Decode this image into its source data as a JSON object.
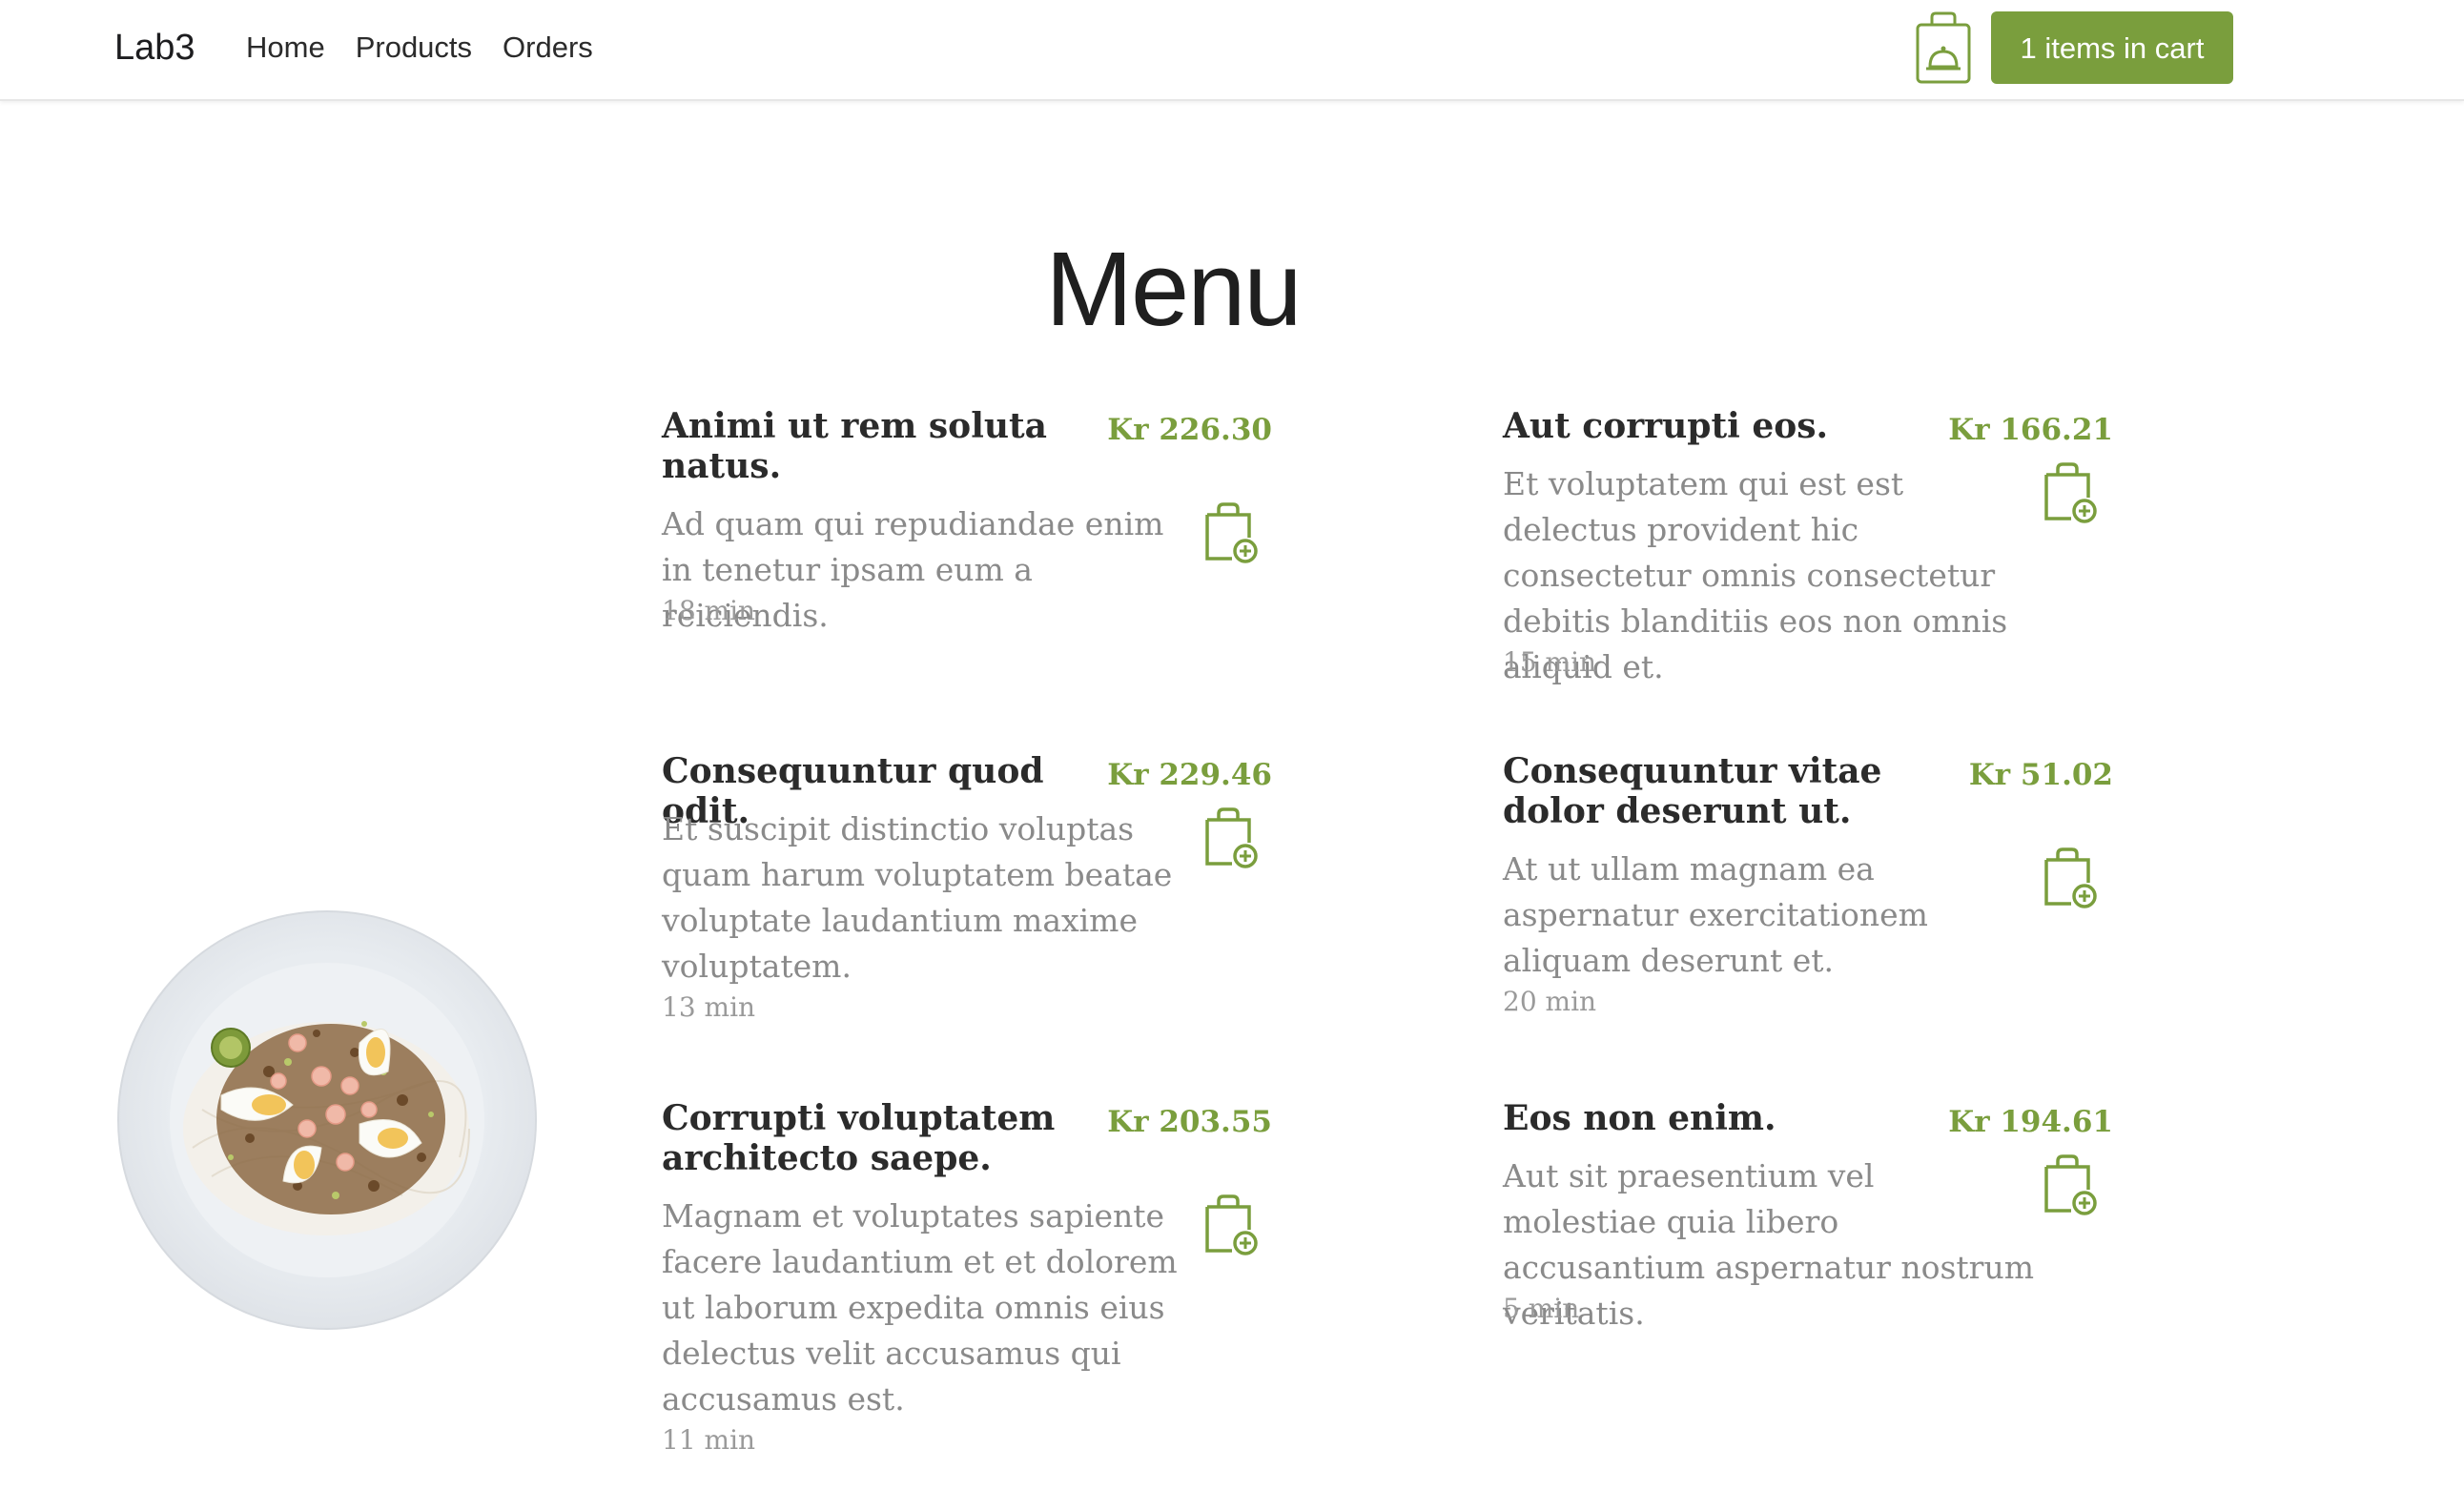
{
  "nav": {
    "brand": "Lab3",
    "links": [
      "Home",
      "Products",
      "Orders"
    ],
    "cart_label": "1 items in cart"
  },
  "page": {
    "title": "Menu"
  },
  "menu": {
    "items": [
      {
        "name": "Animi ut rem soluta natus.",
        "price": "Kr 226.30",
        "description": "Ad quam qui repudiandae enim in tenetur ipsam eum a reiciendis.",
        "time": "18 min"
      },
      {
        "name": "Aut corrupti eos.",
        "price": "Kr 166.21",
        "description": "Et voluptatem qui est est delectus provident hic consectetur omnis consectetur debitis blanditiis eos non omnis aliquid et.",
        "time": "15 min"
      },
      {
        "name": "Consequuntur quod odit.",
        "price": "Kr 229.46",
        "description": "Et suscipit distinctio voluptas quam harum voluptatem beatae voluptate laudantium maxime voluptatem.",
        "time": "13 min"
      },
      {
        "name": "Consequuntur vitae dolor deserunt ut.",
        "price": "Kr 51.02",
        "description": "At ut ullam magnam ea aspernatur exercitationem aliquam deserunt et.",
        "time": "20 min"
      },
      {
        "name": "Corrupti voluptatem architecto saepe.",
        "price": "Kr 203.55",
        "description": "Magnam et voluptates sapiente facere laudantium et et dolorem ut laborum expedita omnis eius delectus velit accusamus qui accusamus est.",
        "time": "11 min"
      },
      {
        "name": "Eos non enim.",
        "price": "Kr 194.61",
        "description": "Aut sit praesentium vel molestiae quia libero accusantium aspernatur nostrum veritatis.",
        "time": "5 min"
      }
    ]
  },
  "colors": {
    "accent": "#7a9e3d",
    "text": "#2b2b2b",
    "muted": "#8a8a8a"
  },
  "icons": {
    "cart": "shopping-bag-cloche-icon",
    "add": "bag-plus-icon",
    "plate": "food-plate-image"
  }
}
